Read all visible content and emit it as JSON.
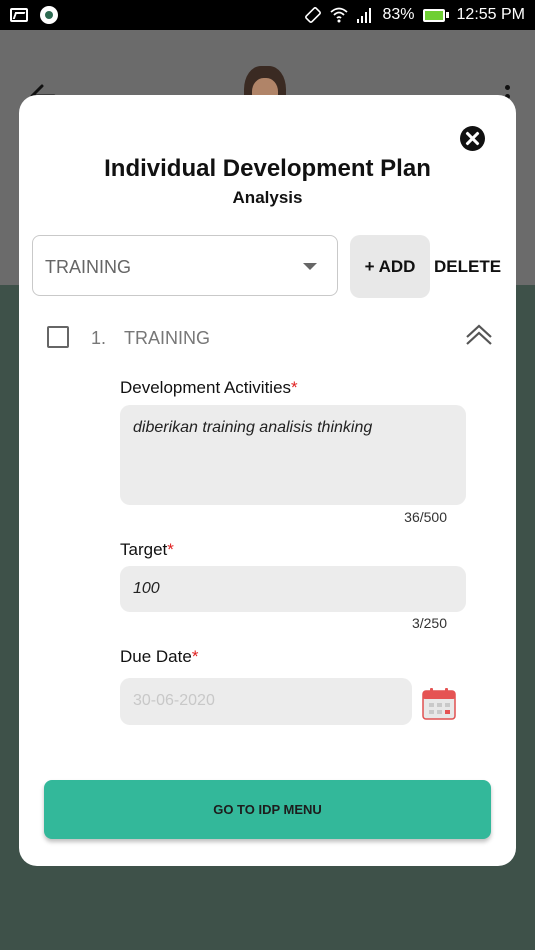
{
  "status_bar": {
    "battery_percent": "83%",
    "time": "12:55 PM"
  },
  "modal": {
    "title": "Individual Development Plan",
    "subtitle": "Analysis",
    "dropdown": {
      "selected": "TRAINING"
    },
    "add_label": "+ ADD",
    "delete_label": "DELETE",
    "item": {
      "number": "1.",
      "label": "TRAINING",
      "development_activities": {
        "label": "Development Activities",
        "required": "*",
        "value": "diberikan training analisis thinking",
        "counter": "36/500"
      },
      "target": {
        "label": "Target",
        "required": "*",
        "value": "100",
        "counter": "3/250"
      },
      "due_date": {
        "label": "Due Date",
        "required": "*",
        "value": "30-06-2020"
      }
    },
    "primary_button": "GO TO IDP MENU"
  },
  "colors": {
    "accent": "#33b89a",
    "required": "#e02020",
    "background": "#3e5149"
  }
}
